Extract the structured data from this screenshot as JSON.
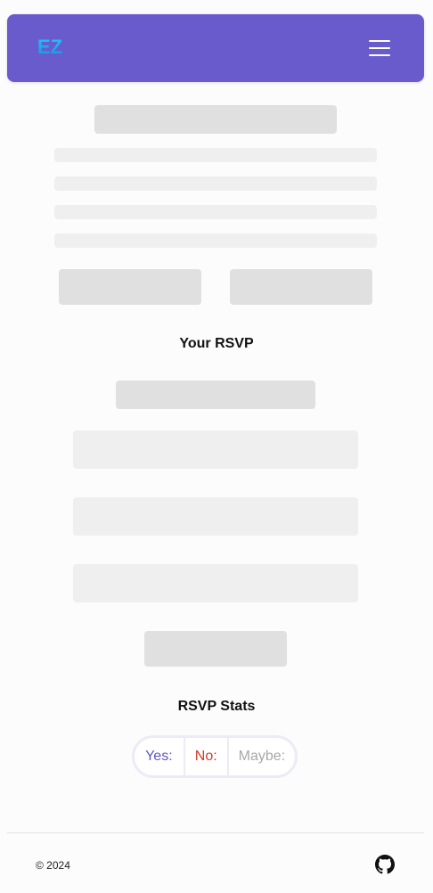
{
  "header": {
    "logo_text": "EZ",
    "menu_icon": "hamburger-menu-icon",
    "background_color": "#6a5bcd"
  },
  "rsvp": {
    "title": "Your RSVP"
  },
  "stats": {
    "title": "RSVP Stats",
    "yes_label": "Yes:",
    "no_label": "No:",
    "maybe_label": "Maybe:",
    "colors": {
      "yes": "#5e56c5",
      "no": "#d23a2a",
      "maybe": "#a8a8a8"
    }
  },
  "footer": {
    "copyright": "© 2024",
    "github_icon": "github-icon"
  }
}
